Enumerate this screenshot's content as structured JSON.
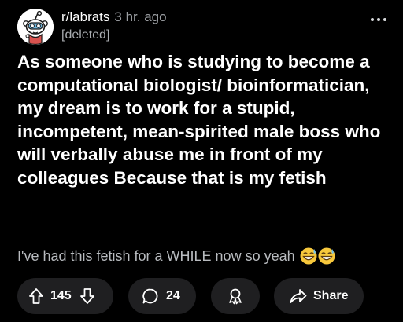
{
  "post": {
    "subreddit": "r/labrats",
    "time_ago": "3 hr. ago",
    "author": "[deleted]",
    "title": "As someone who is studying to become a computational biologist/ bioinformatician, my dream is to work for a stupid, incompetent, mean-spirited male boss who will verbally abuse me in front of my colleagues Because that is my fetish",
    "body": "I've had this fetish for a WHILE now so yeah",
    "body_emojis": [
      "sweat-smile-emoji",
      "sweat-smile-emoji"
    ]
  },
  "actions": {
    "votes": "145",
    "comments": "24",
    "share_label": "Share"
  },
  "icons": {
    "avatar": "reddit-snoo-avatar",
    "more": "more-options-icon",
    "upvote": "upvote-arrow-icon",
    "downvote": "downvote-arrow-icon",
    "comment": "comment-bubble-icon",
    "award": "award-icon",
    "share": "share-arrow-icon"
  },
  "colors": {
    "background": "#000000",
    "pill": "#1f1f21",
    "text_primary": "#ffffff",
    "text_secondary": "#a9acb0",
    "emoji_yellow": "#f7c83c"
  }
}
